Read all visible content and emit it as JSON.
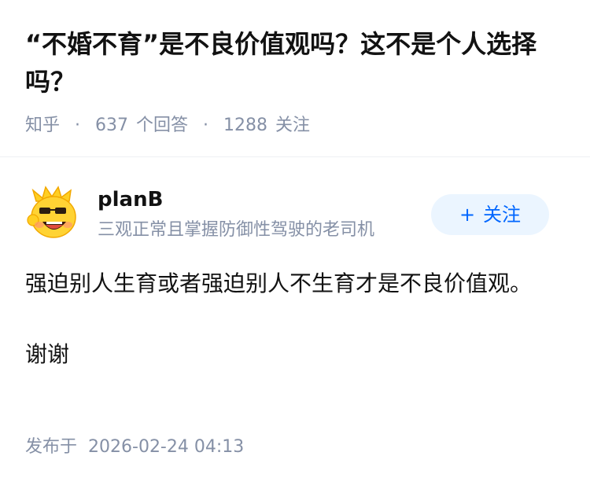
{
  "question": {
    "title": "“不婚不育”是不良价值观吗？这不是个人选择吗？",
    "source": "知乎",
    "separator": "·",
    "answer_count": "637",
    "answer_label": "个回答",
    "follower_count": "1288",
    "follower_label": "关注"
  },
  "answer": {
    "author": {
      "name": "planB",
      "headline": "三观正常且掌握防御性驾驶的老司机",
      "avatar_icon": "smiling-cartoon-face-avatar"
    },
    "follow_button": {
      "icon": "plus-icon",
      "icon_glyph": "+",
      "label": "关注",
      "color": "#0066ff",
      "background": "#ebf5ff"
    },
    "paragraphs": [
      "强迫别人生育或者强迫别人不生育才是不良价值观。",
      "谢谢"
    ],
    "publish_label": "发布于",
    "publish_time": "2026-02-24 04:13"
  },
  "colors": {
    "text_primary": "#121212",
    "text_secondary": "#8590a6",
    "divider": "#eef0f3",
    "avatar_yellow": "#ffcf23"
  }
}
